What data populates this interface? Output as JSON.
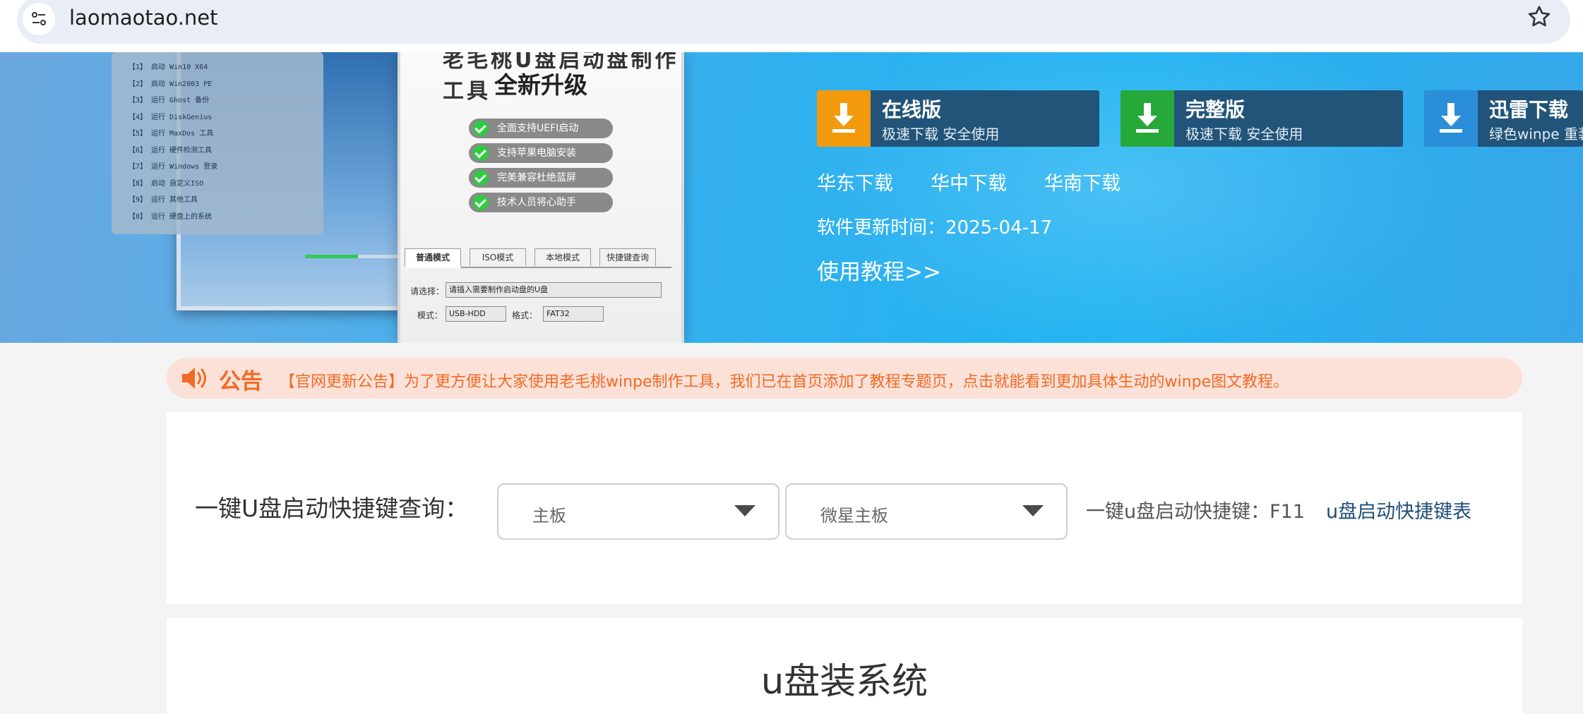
{
  "browser": {
    "url": "laomaotao.net"
  },
  "hero": {
    "screenshot": {
      "partial_title": "老毛桃U盘启动盘制作工具",
      "title": "全新升级",
      "features": [
        "全面支持UEFI启动",
        "支持苹果电脑安装",
        "完美兼容杜绝蓝屏",
        "技术人员将心助手"
      ],
      "tabs": [
        "普通模式",
        "ISO模式",
        "本地模式",
        "快捷键查询"
      ],
      "select_label": "请选择：",
      "select_value": "请插入需要制作启动盘的U盘",
      "mode_label": "模式：",
      "mode_value": "USB-HDD",
      "format_label": "格式：",
      "format_value": "FAT32",
      "boot_menu": [
        "【1】 启动 Win10 X64",
        "【2】 启动 Win2003 PE",
        "【3】 运行 Ghost 备份",
        "【4】 运行 DiskGenius",
        "【5】 运行 MaxDos 工具",
        "【6】 运行 硬件检测工具",
        "【7】 运行 Windows 登录",
        "【8】 启动 自定义ISO",
        "【9】 运行 其他工具",
        "【0】 运行 硬盘上的系统"
      ]
    },
    "downloads": [
      {
        "title": "在线版",
        "subtitle": "极速下载 安全使用",
        "color": "#f29a0c"
      },
      {
        "title": "完整版",
        "subtitle": "极速下载 安全使用",
        "color": "#27a93a"
      },
      {
        "title": "迅雷下载",
        "subtitle": "绿色winpe 重装",
        "color": "#2a8ed8"
      }
    ],
    "mirrors": [
      "华东下载",
      "华中下载",
      "华南下载"
    ],
    "update_time": "软件更新时间：2025-04-17",
    "tutorial": "使用教程>>"
  },
  "notice": {
    "label": "公告",
    "text": "【官网更新公告】为了更方便让大家使用老毛桃winpe制作工具，我们已在首页添加了教程专题页，点击就能看到更加具体生动的winpe图文教程。"
  },
  "shortcut": {
    "label": "一键U盘启动快捷键查询：",
    "category_value": "主板",
    "brand_value": "微星主板",
    "result": "一键u盘启动快捷键：F11",
    "table_link": "u盘启动快捷键表"
  },
  "section": {
    "title": "u盘装系统"
  },
  "colors": {
    "accent_orange": "#f26a24",
    "download_button_bg": "#225479",
    "link_blue": "#1e4d78"
  }
}
